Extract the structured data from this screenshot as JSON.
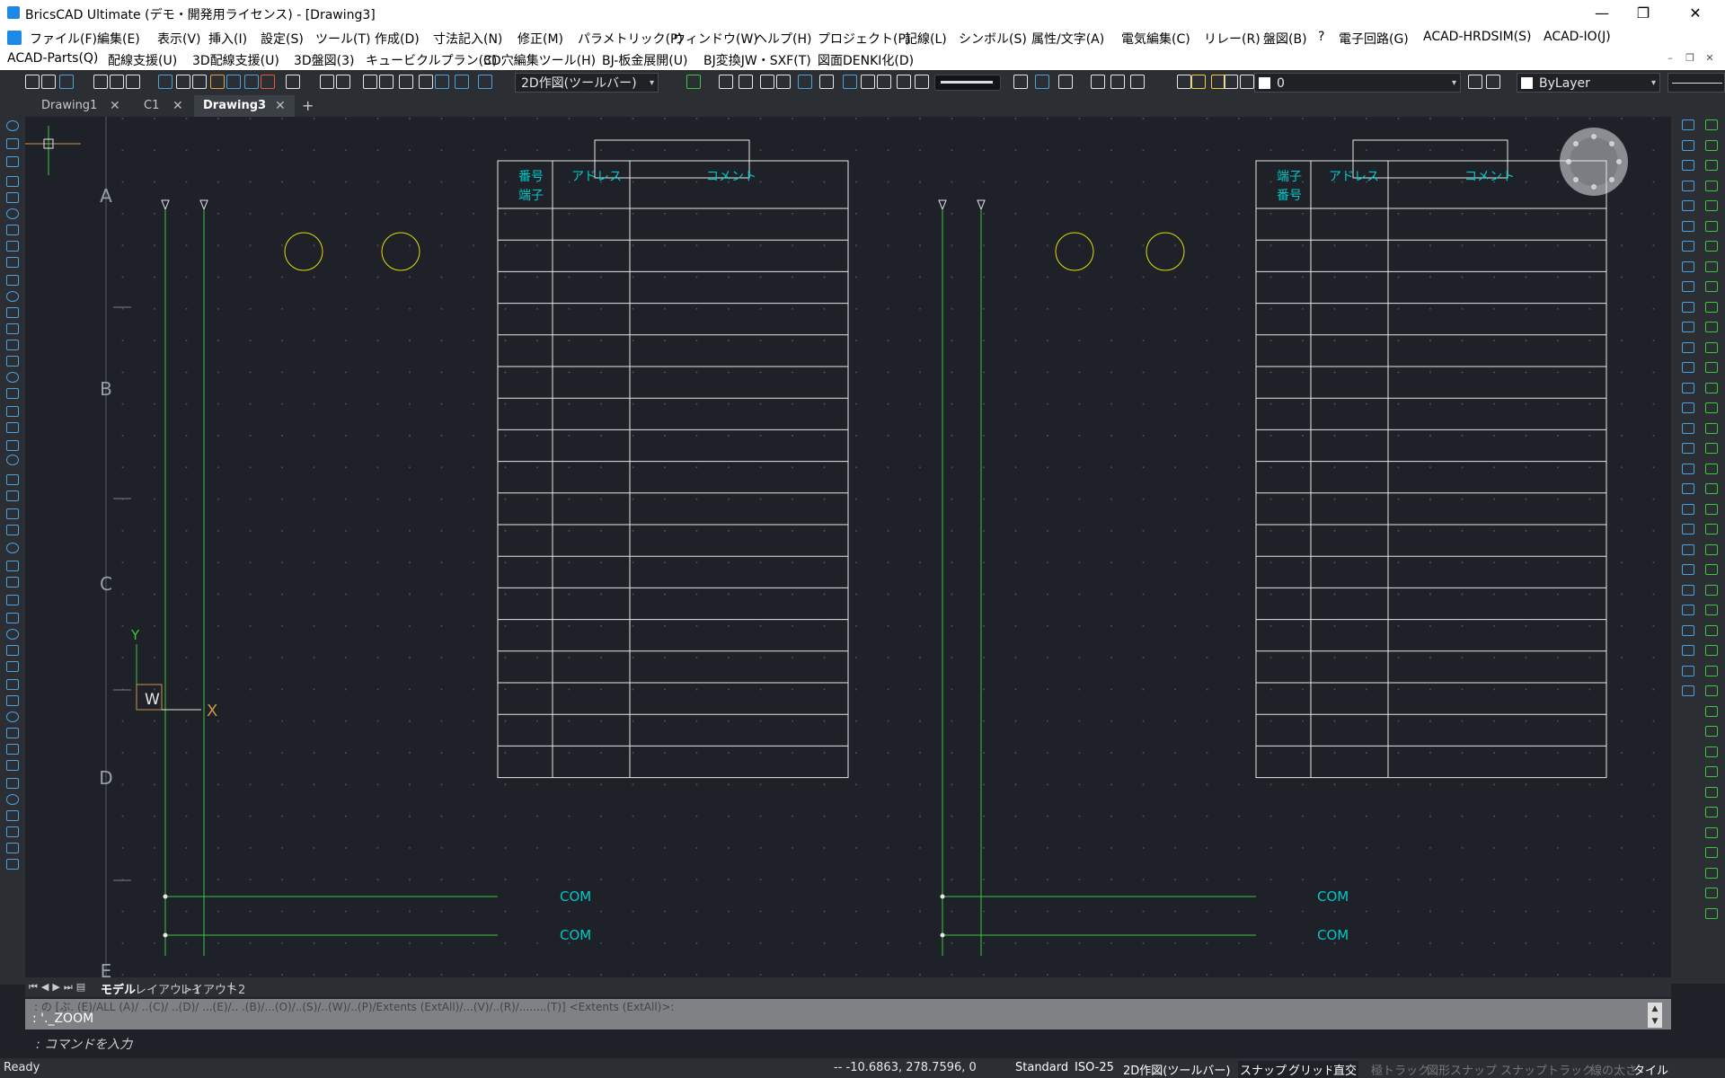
{
  "window": {
    "title": "BricsCAD Ultimate (デモ・開発用ライセンス) - [Drawing3]",
    "minimize": "—",
    "restore": "❐",
    "close": "✕"
  },
  "menu1": [
    "ファイル(F)",
    "編集(E)",
    "表示(V)",
    "挿入(I)",
    "設定(S)",
    "ツール(T)",
    "作成(D)",
    "寸法記入(N)",
    "修正(M)",
    "パラメトリック(P)",
    "ウィンドウ(W)",
    "ヘルプ(H)",
    "プロジェクト(P)",
    "記線(L)",
    "シンボル(S)",
    "属性/文字(A)",
    "電気編集(C)",
    "リレー(R)",
    "盤図(B)",
    "?",
    "電子回路(G)",
    "ACAD-HRDSIM(S)",
    "ACAD-IO(J)"
  ],
  "menu2": [
    "ACAD-Parts(Q)",
    "配線支援(U)",
    "3D配線支援(U)",
    "3D盤図(3)",
    "キュービクルプラン(C)",
    "3D穴編集ツール(H)",
    "BJ-板金展開(U)",
    "BJ変換JW・SXF(T)",
    "図面DENKI化(D)"
  ],
  "toolbar": {
    "workspace": "2D作図(ツールバー)",
    "layer": "0",
    "linetype": "ByLayer"
  },
  "doc_tabs": [
    {
      "label": "Drawing1",
      "active": false
    },
    {
      "label": "C1",
      "active": false
    },
    {
      "label": "Drawing3",
      "active": true
    }
  ],
  "add_tab": "+",
  "drawing": {
    "row_labels": [
      "A",
      "B",
      "C",
      "D",
      "E"
    ],
    "left_table": {
      "header": [
        "番号\n端子",
        "アドレス",
        "コメント"
      ],
      "header_line1": "番号",
      "header_line2": "端子",
      "addr": "アドレス",
      "comment": "コメント",
      "com_rows": [
        "COM",
        "COM"
      ]
    },
    "right_table": {
      "header_line1": "端子",
      "header_line2": "番号",
      "addr": "アドレス",
      "comment": "コメント",
      "com_rows": [
        "COM",
        "COM"
      ]
    },
    "ucs": {
      "y": "Y",
      "x": "X",
      "w": "W"
    },
    "colors": {
      "cyan": "#00c8c8",
      "green": "#3cc83c",
      "yellow": "#e0e000",
      "white": "#e6e6e6"
    }
  },
  "layout_tabs": [
    "モデル",
    "レイアウト1",
    "レイアウト2",
    "+"
  ],
  "command": {
    "history": ": の [ぶ.  (E)/ALL  (A)/ ..(C)/ ..(D)/ ...(E)/.. .(B)/...(O)/..(S)/..(W)/..(P)/Extents  (ExtAll)/...(V)/..(R)/........(T)] <Extents (ExtAll)>:",
    "last": ": '._ZOOM",
    "prompt": ": コマンドを入力"
  },
  "status": {
    "ready": "Ready",
    "coords": "-- -10.6863, 278.7596, 0",
    "items": [
      {
        "label": "Standard",
        "state": "on"
      },
      {
        "label": "ISO-25",
        "state": "on"
      },
      {
        "label": "2D作図(ツールバー)",
        "state": "on"
      },
      {
        "label": "スナップ",
        "state": "boxed"
      },
      {
        "label": "グリッド",
        "state": "boxed"
      },
      {
        "label": "直交",
        "state": "boxed"
      },
      {
        "label": "極トラック",
        "state": "off"
      },
      {
        "label": "図形スナップ",
        "state": "off"
      },
      {
        "label": "スナップトラック",
        "state": "off"
      },
      {
        "label": "線の太さ",
        "state": "off"
      },
      {
        "label": "タイル",
        "state": "on"
      }
    ]
  }
}
